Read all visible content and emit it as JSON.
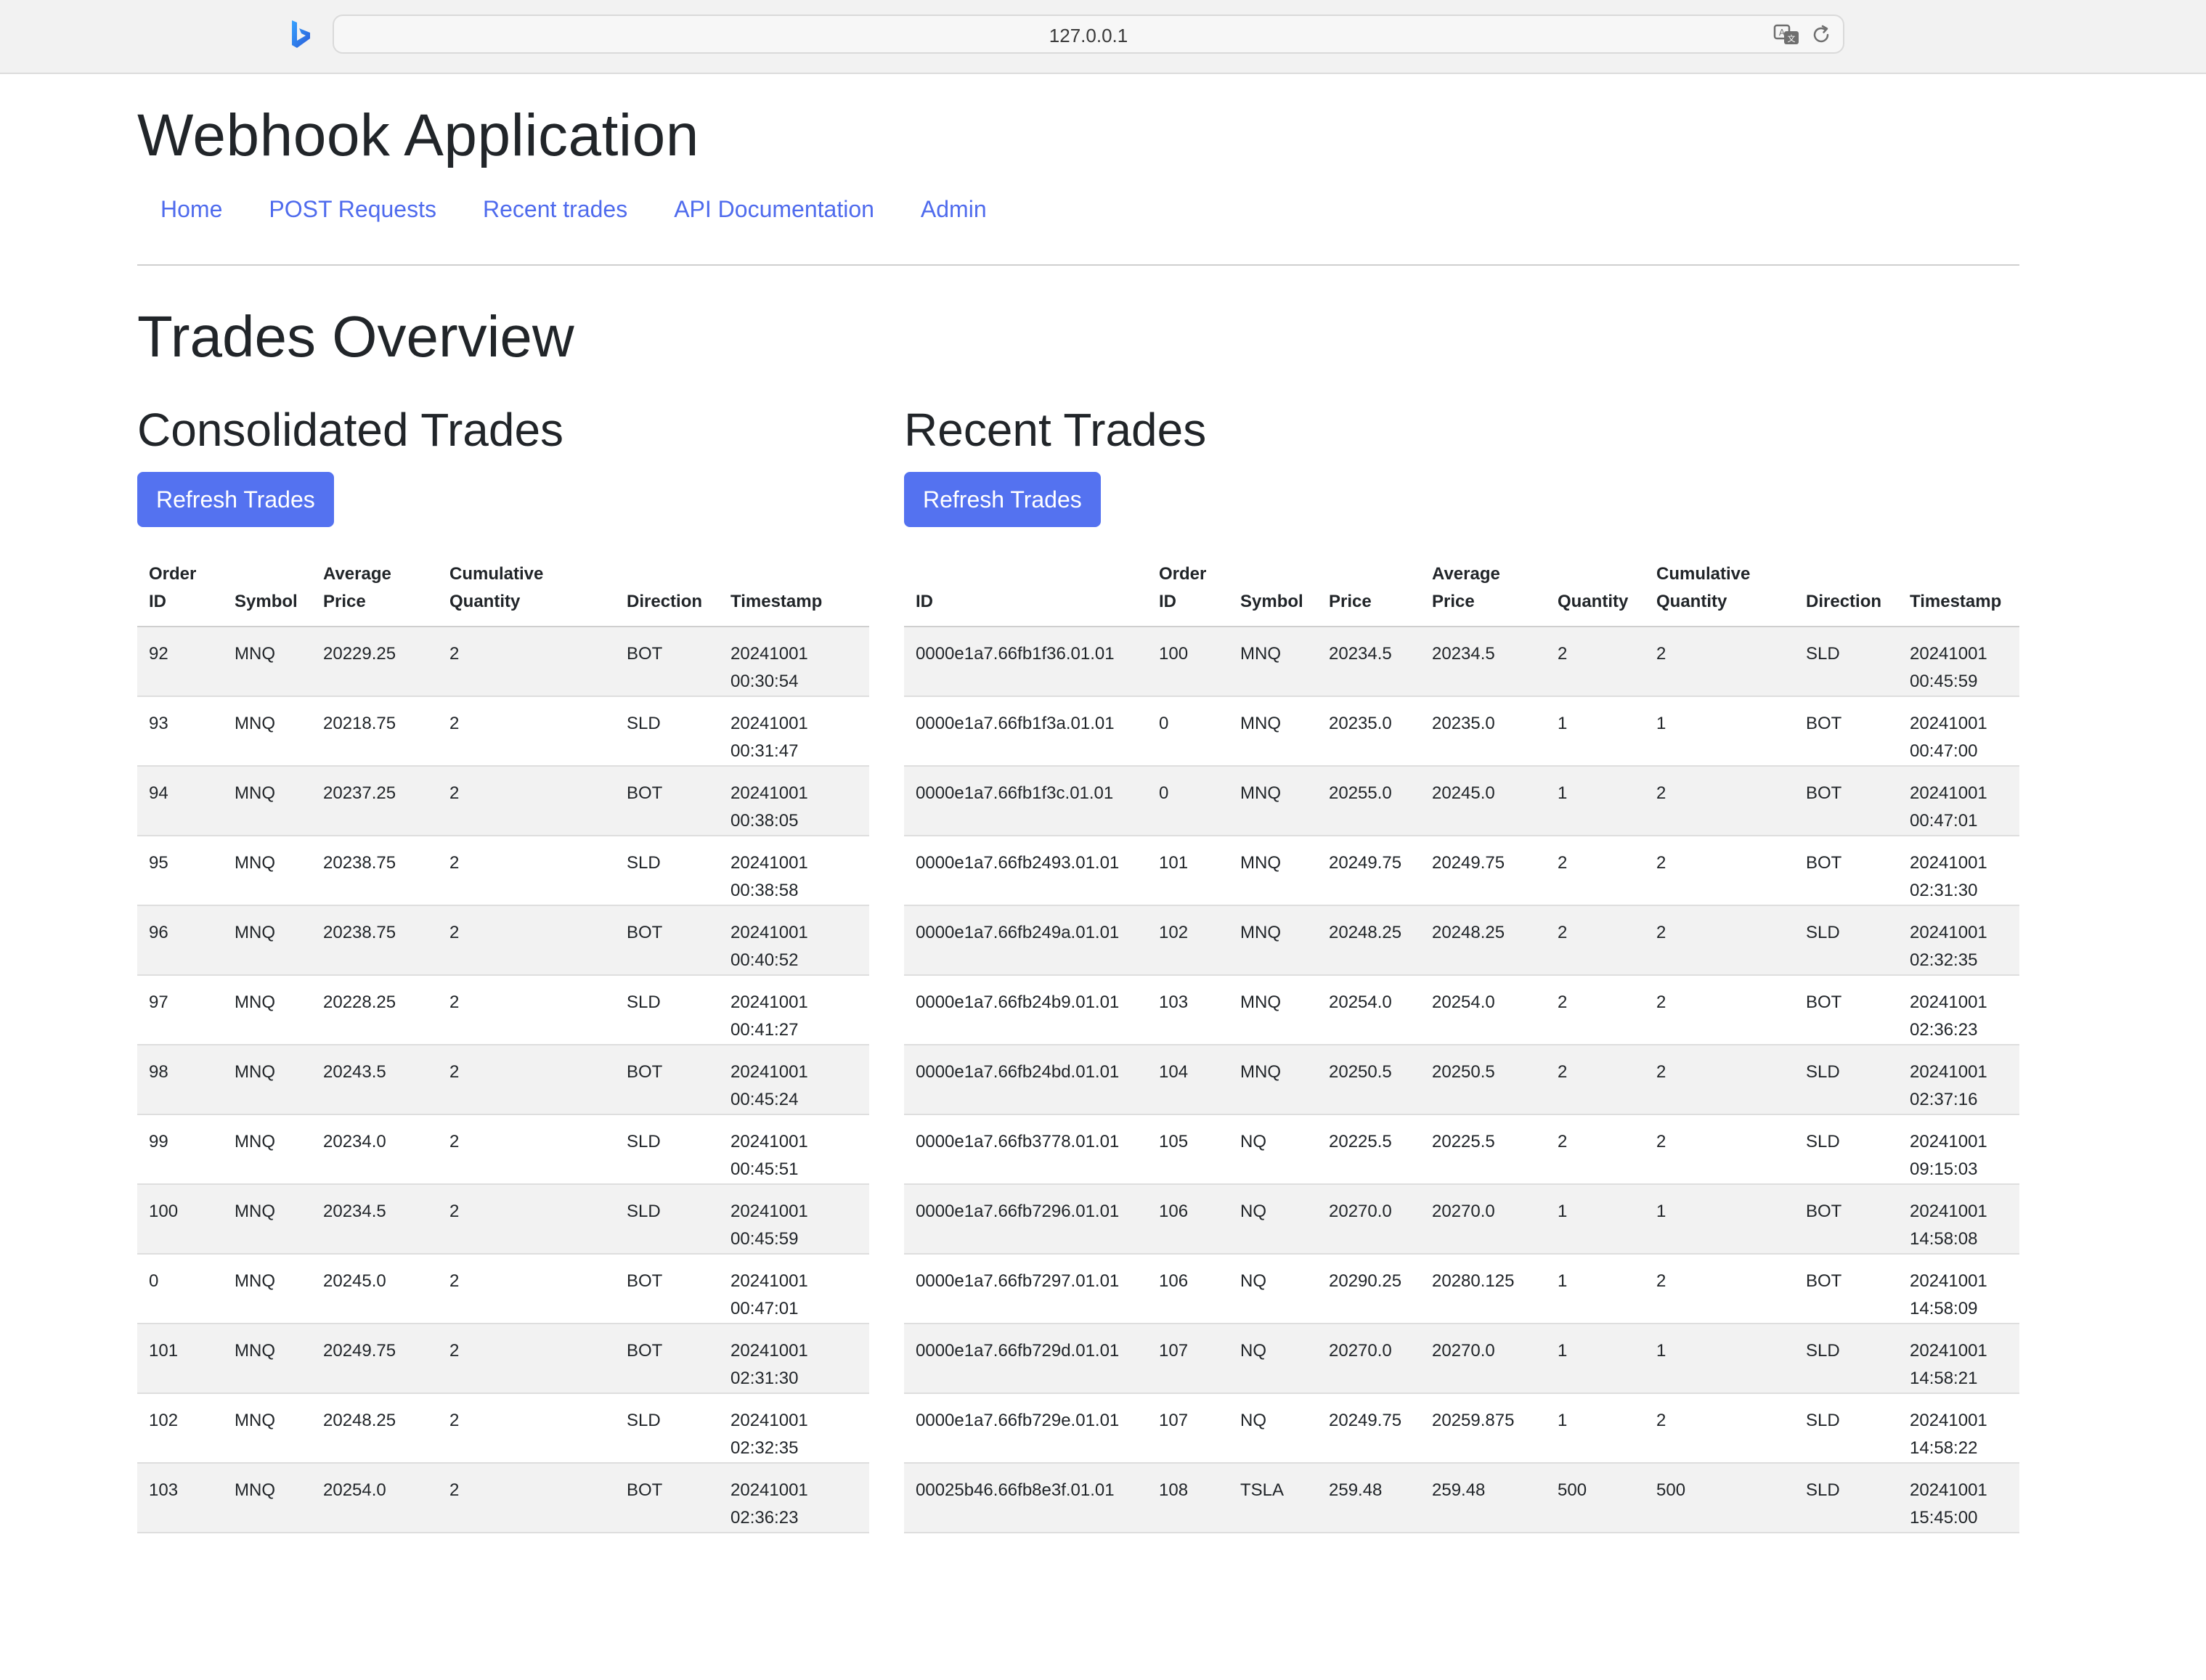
{
  "browser": {
    "url": "127.0.0.1",
    "logo_icon": "bing-logo-icon",
    "translate_icon": "translate-icon",
    "reload_icon": "reload-icon"
  },
  "app": {
    "title": "Webhook Application",
    "nav": [
      "Home",
      "POST Requests",
      "Recent trades",
      "API Documentation",
      "Admin"
    ]
  },
  "page": {
    "title": "Trades Overview"
  },
  "consolidated": {
    "title": "Consolidated Trades",
    "button": "Refresh Trades",
    "columns": [
      "Order\nID",
      "Symbol",
      "Average\nPrice",
      "Cumulative\nQuantity",
      "Direction",
      "Timestamp"
    ],
    "rows": [
      [
        "92",
        "MNQ",
        "20229.25",
        "2",
        "BOT",
        "20241001\n00:30:54"
      ],
      [
        "93",
        "MNQ",
        "20218.75",
        "2",
        "SLD",
        "20241001\n00:31:47"
      ],
      [
        "94",
        "MNQ",
        "20237.25",
        "2",
        "BOT",
        "20241001\n00:38:05"
      ],
      [
        "95",
        "MNQ",
        "20238.75",
        "2",
        "SLD",
        "20241001\n00:38:58"
      ],
      [
        "96",
        "MNQ",
        "20238.75",
        "2",
        "BOT",
        "20241001\n00:40:52"
      ],
      [
        "97",
        "MNQ",
        "20228.25",
        "2",
        "SLD",
        "20241001\n00:41:27"
      ],
      [
        "98",
        "MNQ",
        "20243.5",
        "2",
        "BOT",
        "20241001\n00:45:24"
      ],
      [
        "99",
        "MNQ",
        "20234.0",
        "2",
        "SLD",
        "20241001\n00:45:51"
      ],
      [
        "100",
        "MNQ",
        "20234.5",
        "2",
        "SLD",
        "20241001\n00:45:59"
      ],
      [
        "0",
        "MNQ",
        "20245.0",
        "2",
        "BOT",
        "20241001\n00:47:01"
      ],
      [
        "101",
        "MNQ",
        "20249.75",
        "2",
        "BOT",
        "20241001\n02:31:30"
      ],
      [
        "102",
        "MNQ",
        "20248.25",
        "2",
        "SLD",
        "20241001\n02:32:35"
      ],
      [
        "103",
        "MNQ",
        "20254.0",
        "2",
        "BOT",
        "20241001\n02:36:23"
      ]
    ]
  },
  "recent": {
    "title": "Recent Trades",
    "button": "Refresh Trades",
    "columns": [
      "ID",
      "Order\nID",
      "Symbol",
      "Price",
      "Average\nPrice",
      "Quantity",
      "Cumulative\nQuantity",
      "Direction",
      "Timestamp"
    ],
    "rows": [
      [
        "0000e1a7.66fb1f36.01.01",
        "100",
        "MNQ",
        "20234.5",
        "20234.5",
        "2",
        "2",
        "SLD",
        "20241001\n00:45:59"
      ],
      [
        "0000e1a7.66fb1f3a.01.01",
        "0",
        "MNQ",
        "20235.0",
        "20235.0",
        "1",
        "1",
        "BOT",
        "20241001\n00:47:00"
      ],
      [
        "0000e1a7.66fb1f3c.01.01",
        "0",
        "MNQ",
        "20255.0",
        "20245.0",
        "1",
        "2",
        "BOT",
        "20241001\n00:47:01"
      ],
      [
        "0000e1a7.66fb2493.01.01",
        "101",
        "MNQ",
        "20249.75",
        "20249.75",
        "2",
        "2",
        "BOT",
        "20241001\n02:31:30"
      ],
      [
        "0000e1a7.66fb249a.01.01",
        "102",
        "MNQ",
        "20248.25",
        "20248.25",
        "2",
        "2",
        "SLD",
        "20241001\n02:32:35"
      ],
      [
        "0000e1a7.66fb24b9.01.01",
        "103",
        "MNQ",
        "20254.0",
        "20254.0",
        "2",
        "2",
        "BOT",
        "20241001\n02:36:23"
      ],
      [
        "0000e1a7.66fb24bd.01.01",
        "104",
        "MNQ",
        "20250.5",
        "20250.5",
        "2",
        "2",
        "SLD",
        "20241001\n02:37:16"
      ],
      [
        "0000e1a7.66fb3778.01.01",
        "105",
        "NQ",
        "20225.5",
        "20225.5",
        "2",
        "2",
        "SLD",
        "20241001\n09:15:03"
      ],
      [
        "0000e1a7.66fb7296.01.01",
        "106",
        "NQ",
        "20270.0",
        "20270.0",
        "1",
        "1",
        "BOT",
        "20241001\n14:58:08"
      ],
      [
        "0000e1a7.66fb7297.01.01",
        "106",
        "NQ",
        "20290.25",
        "20280.125",
        "1",
        "2",
        "BOT",
        "20241001\n14:58:09"
      ],
      [
        "0000e1a7.66fb729d.01.01",
        "107",
        "NQ",
        "20270.0",
        "20270.0",
        "1",
        "1",
        "SLD",
        "20241001\n14:58:21"
      ],
      [
        "0000e1a7.66fb729e.01.01",
        "107",
        "NQ",
        "20249.75",
        "20259.875",
        "1",
        "2",
        "SLD",
        "20241001\n14:58:22"
      ],
      [
        "00025b46.66fb8e3f.01.01",
        "108",
        "TSLA",
        "259.48",
        "259.48",
        "500",
        "500",
        "SLD",
        "20241001\n15:45:00"
      ]
    ]
  }
}
